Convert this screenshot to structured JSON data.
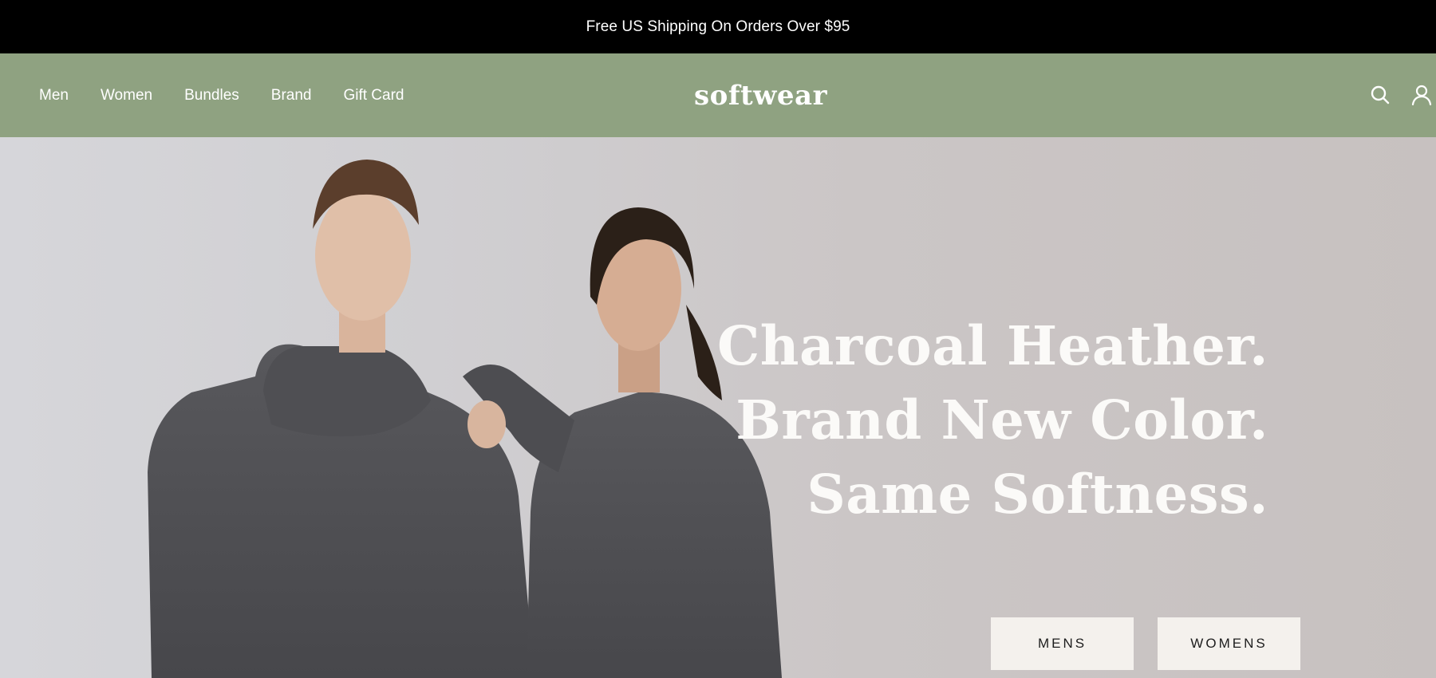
{
  "announcement": {
    "text": "Free US Shipping On Orders Over $95"
  },
  "header": {
    "nav": [
      "Men",
      "Women",
      "Bundles",
      "Brand",
      "Gift Card"
    ],
    "logo": "softwear",
    "icons": [
      "search-icon",
      "account-icon"
    ]
  },
  "hero": {
    "headline": [
      "Charcoal Heather.",
      "Brand New Color.",
      "Same Softness."
    ],
    "buttons": {
      "mens": "MENS",
      "womens": "WOMENS"
    }
  },
  "colors": {
    "announcement_bg": "#000000",
    "header_bg": "#8fa281",
    "button_bg": "#f4f1ed",
    "headline_text": "#fbfaf8"
  }
}
